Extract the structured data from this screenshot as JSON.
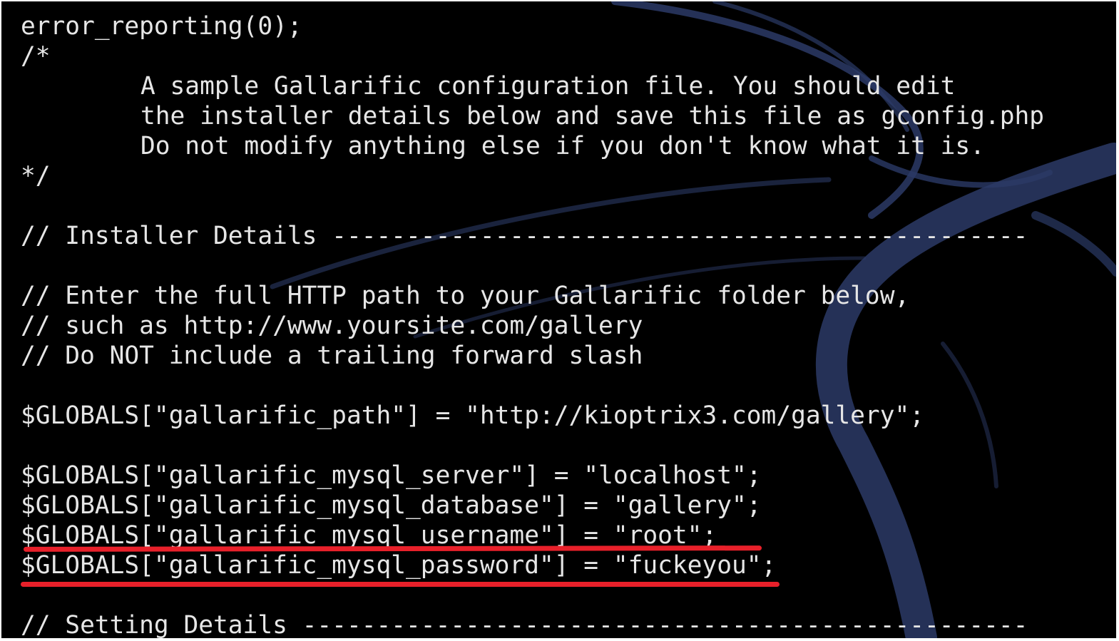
{
  "terminal": {
    "lines": [
      {
        "text": "error_reporting(0);",
        "indent": false
      },
      {
        "text": "/*",
        "indent": false
      },
      {
        "text": "A sample Gallarific configuration file. You should edit",
        "indent": true
      },
      {
        "text": "the installer details below and save this file as gconfig.php",
        "indent": true
      },
      {
        "text": "Do not modify anything else if you don't know what it is.",
        "indent": true
      },
      {
        "text": "*/",
        "indent": false
      },
      {
        "text": "",
        "indent": false
      },
      {
        "text": "// Installer Details -----------------------------------------------",
        "indent": false
      },
      {
        "text": "",
        "indent": false
      },
      {
        "text": "// Enter the full HTTP path to your Gallarific folder below,",
        "indent": false
      },
      {
        "text": "// such as http://www.yoursite.com/gallery",
        "indent": false
      },
      {
        "text": "// Do NOT include a trailing forward slash",
        "indent": false
      },
      {
        "text": "",
        "indent": false
      },
      {
        "text": "$GLOBALS[\"gallarific_path\"] = \"http://kioptrix3.com/gallery\";",
        "indent": false
      },
      {
        "text": "",
        "indent": false
      },
      {
        "text": "$GLOBALS[\"gallarific_mysql_server\"] = \"localhost\";",
        "indent": false
      },
      {
        "text": "$GLOBALS[\"gallarific_mysql_database\"] = \"gallery\";",
        "indent": false
      },
      {
        "text": "$GLOBALS[\"gallarific_mysql_username\"] = \"root\";",
        "indent": false
      },
      {
        "text": "$GLOBALS[\"gallarific_mysql_password\"] = \"fuckeyou\";",
        "indent": false
      },
      {
        "text": "",
        "indent": false
      },
      {
        "text": "// Setting Details -------------------------------------------------",
        "indent": false
      }
    ],
    "text_color": "#e6e6e6",
    "background_color": "#000000",
    "wallpaper_color": "#2b3a66",
    "highlight_color": "#e8202a"
  }
}
